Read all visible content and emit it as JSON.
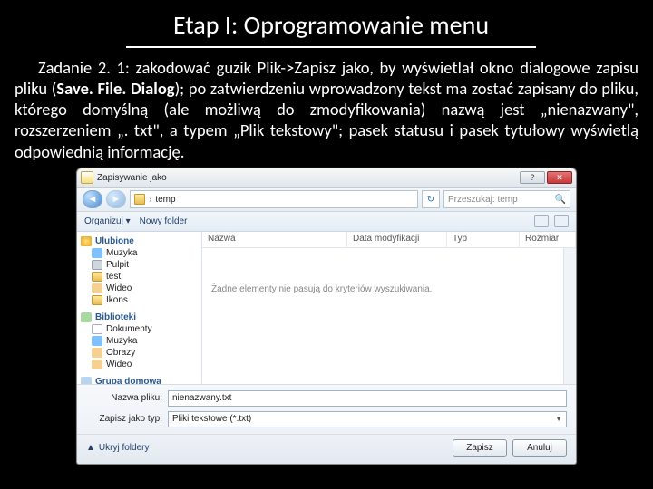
{
  "slide": {
    "title": "Etap I: Oprogramowanie menu",
    "body_pre": "Zadanie 2. 1: zakodować guzik Plik->Zapisz jako, by wyświetlał okno dialogowe zapisu pliku (",
    "body_bold": "Save. File. Dialog",
    "body_post": "); po zatwierdzeniu wprowadzony tekst ma zostać zapisany do pliku, którego domyślną (ale możliwą do zmodyfikowania) nazwą jest „nienazwany\", rozszerzeniem „. txt\", a typem „Plik tekstowy\"; pasek statusu i pasek tytułowy wyświetlą odpowiednią informację."
  },
  "dialog": {
    "title": "Zapisywanie jako",
    "path_seg1": "temp",
    "search_placeholder": "Przeszukaj: temp",
    "toolbar": {
      "organize": "Organizuj ▾",
      "newfolder": "Nowy folder"
    },
    "columns": {
      "name": "Nazwa",
      "date": "Data modyfikacji",
      "type": "Typ",
      "size": "Rozmiar"
    },
    "empty_msg": "Żadne elementy nie pasują do kryteriów wyszukiwania.",
    "tree": {
      "fav_title": "Ulubione",
      "fav_items": [
        "Muzyka",
        "Pulpit",
        "test",
        "Wideo",
        "Ikons"
      ],
      "lib_title": "Biblioteki",
      "lib_items": [
        "Dokumenty",
        "Muzyka",
        "Obrazy",
        "Wideo"
      ],
      "home_title": "Grupa domowa"
    },
    "filename_label": "Nazwa pliku:",
    "filename_value": "nienazwany.txt",
    "filetype_label": "Zapisz jako typ:",
    "filetype_value": "Pliki tekstowe (*.txt)",
    "hide_folders": "Ukryj foldery",
    "btn_save": "Zapisz",
    "btn_cancel": "Anuluj"
  }
}
